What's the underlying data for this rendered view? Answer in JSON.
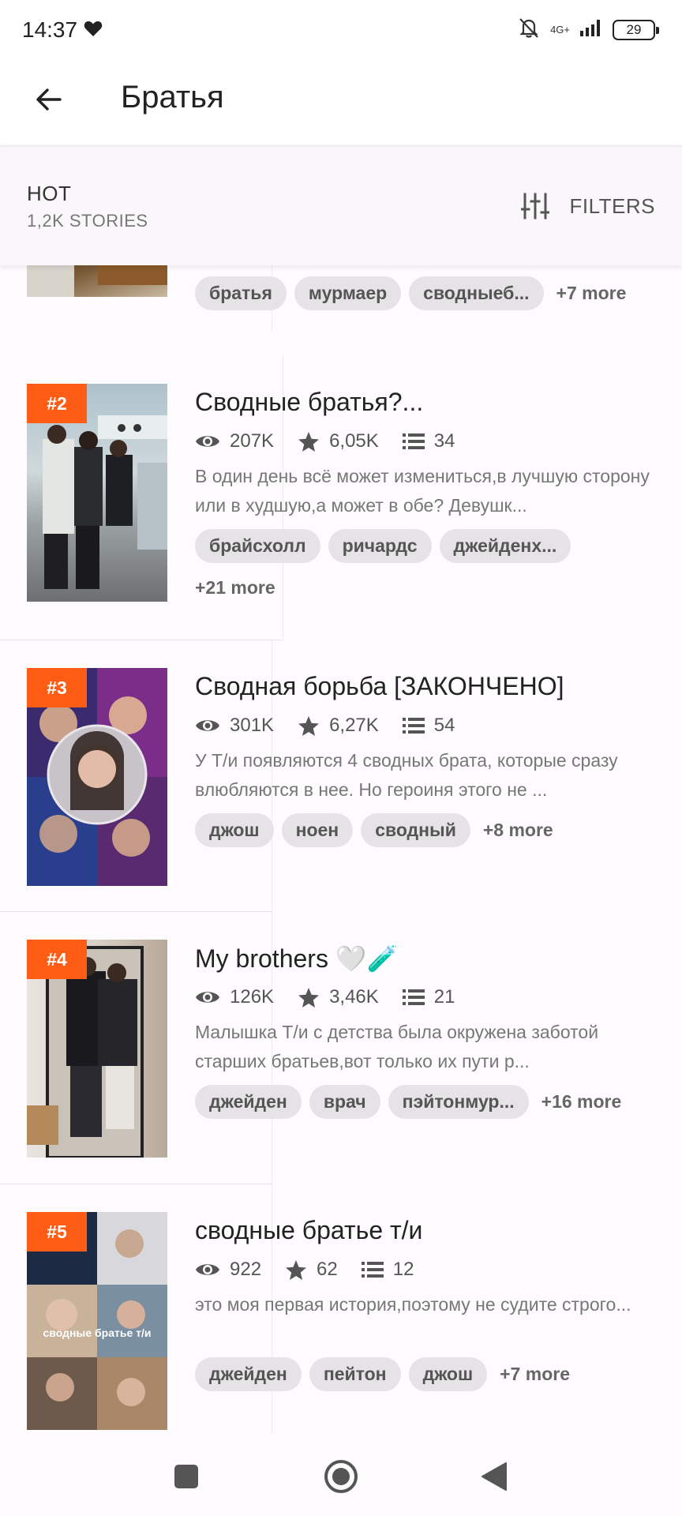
{
  "status_bar": {
    "time": "14:37",
    "network": "4G+",
    "battery": "29"
  },
  "app_bar": {
    "title": "Братья"
  },
  "filter_bar": {
    "sort": "HOT",
    "count": "1,2K STORIES",
    "filters_label": "FILTERS"
  },
  "stories": [
    {
      "rank": "",
      "title": "",
      "tags": [
        "братья",
        "мурмаер",
        "сводныеб..."
      ],
      "more": "+7 more"
    },
    {
      "rank": "#2",
      "title": "Сводные братья?...",
      "reads": "207K",
      "votes": "6,05K",
      "parts": "34",
      "description": "В один день всё может измениться,в лучшую сторону или в худшую,а может в обе? Девушк...",
      "tags": [
        "брайсхолл",
        "ричардс",
        "джейденх..."
      ],
      "more": "+21 more"
    },
    {
      "rank": "#3",
      "title": "Сводная борьба [ЗАКОНЧЕНО]",
      "reads": "301K",
      "votes": "6,27K",
      "parts": "54",
      "description": "У Т/и появляются 4 сводных брата, которые сразу влюбляются в нее. Но героиня этого не ...",
      "tags": [
        "джош",
        "ноен",
        "сводный"
      ],
      "more": "+8 more"
    },
    {
      "rank": "#4",
      "title": "My brothers 🤍🧪",
      "reads": "126K",
      "votes": "3,46K",
      "parts": "21",
      "description": "Малышка Т/и с детства была окружена заботой старших братьев,вот только их пути р...",
      "tags": [
        "джейден",
        "врач",
        "пэйтонмур..."
      ],
      "more": "+16 more"
    },
    {
      "rank": "#5",
      "title": "сводные братье т/и",
      "reads": "922",
      "votes": "62",
      "parts": "12",
      "description": "это моя первая история,поэтому не судите строго...",
      "cover_caption": "сводные братье т/и",
      "tags": [
        "джейден",
        "пейтон",
        "джош"
      ],
      "more": "+7 more"
    }
  ]
}
